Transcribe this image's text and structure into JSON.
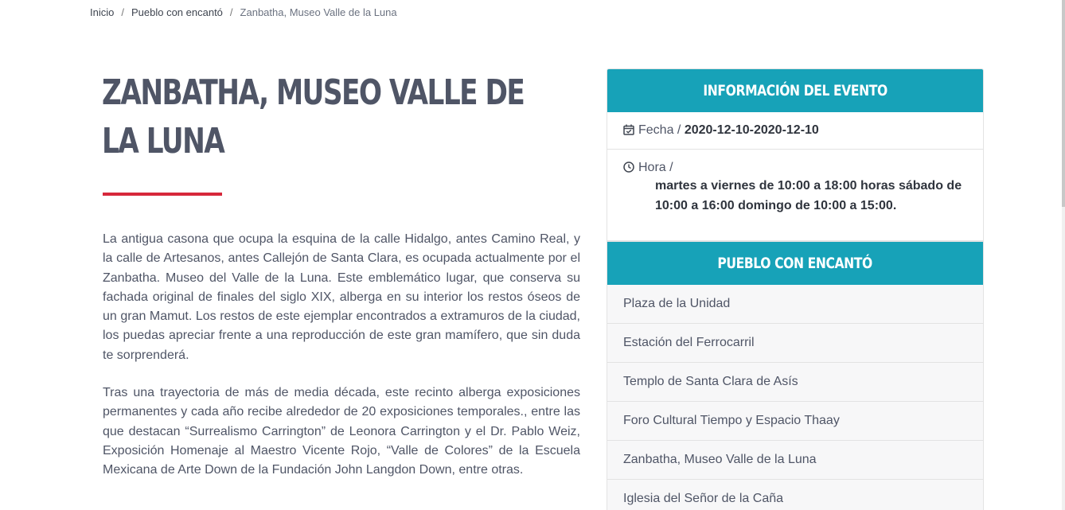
{
  "breadcrumb": {
    "home": "Inicio",
    "section": "Pueblo con encantó",
    "current": "Zanbatha, Museo Valle de la Luna",
    "separator": "/"
  },
  "article": {
    "title": "ZANBATHA, MUSEO VALLE DE LA LUNA",
    "paragraph1": "La antigua casona que ocupa la esquina de la calle Hidalgo, antes Camino Real, y la calle de Artesanos, antes Callejón de Santa Clara, es ocupada actualmente por el Zanbatha. Museo del Valle de la Luna. Este emblemático lugar, que conserva su fachada original de finales del siglo XIX, alberga en su interior los restos óseos de un gran Mamut. Los restos de este ejemplar encontrados a extramuros de la ciudad, los puedas apreciar frente a una reproducción de este gran mamífero, que sin duda te sorprenderá.",
    "paragraph2": "Tras una trayectoria de más de media década, este recinto alberga exposiciones permanentes y cada año recibe alrededor de 20 exposiciones temporales., entre las que destacan “Surrealismo Carrington” de Leonora Carrington y el Dr. Pablo Weiz, Exposición Homenaje al Maestro Vicente Rojo, “Valle de Colores” de la Escuela Mexicana de Arte Down de la Fundación John Langdon Down, entre otras."
  },
  "event_info": {
    "heading": "INFORMACIÓN DEL EVENTO",
    "date_label": "Fecha /",
    "date_value": "2020-12-10-2020-12-10",
    "time_label": "Hora /",
    "time_value": "martes a viernes de 10:00 a 18:00 horas sábado de 10:00 a 16:00 domingo de 10:00 a 15:00."
  },
  "places": {
    "heading": "PUEBLO CON ENCANTÓ",
    "items": [
      "Plaza de la Unidad",
      "Estación del Ferrocarril",
      "Templo de Santa Clara de Asís",
      "Foro Cultural Tiempo y Espacio Thaay",
      "Zanbatha, Museo Valle de la Luna",
      "Iglesia del Señor de la Caña"
    ]
  },
  "colors": {
    "accent": "#17a2b8",
    "title_rule": "#d6283b",
    "title_text": "#4f5566"
  },
  "icons": {
    "date": "calendar-check-icon",
    "time": "clock-icon"
  }
}
